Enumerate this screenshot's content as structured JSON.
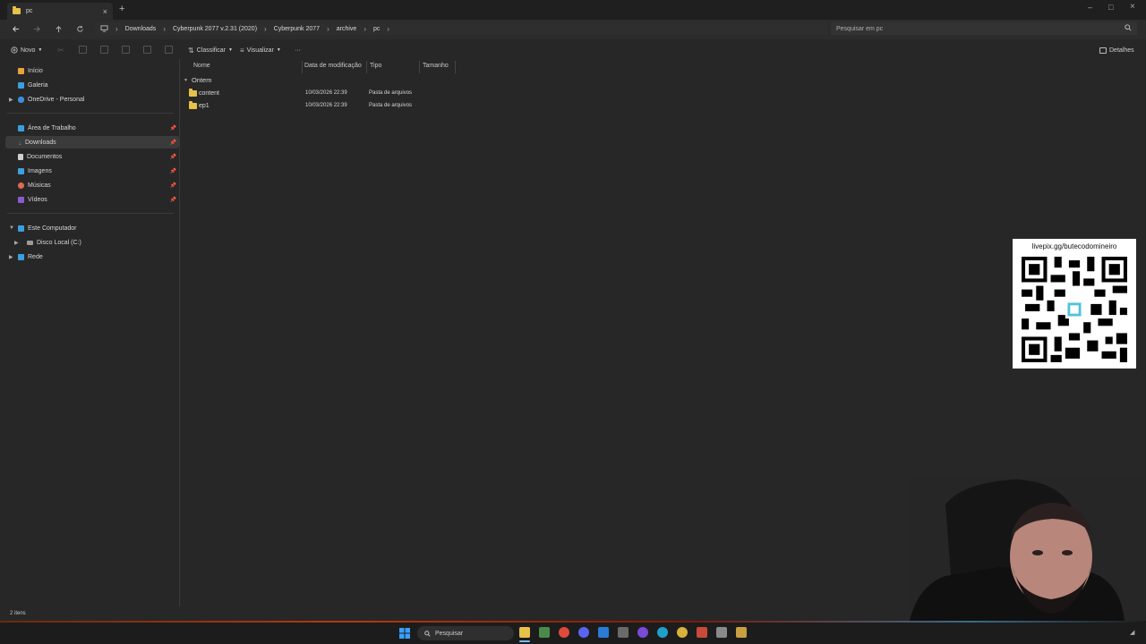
{
  "window": {
    "tab_title": "pc",
    "tab_close": "×",
    "new_tab": "+",
    "min": "–",
    "max": "□",
    "close": "×"
  },
  "address": {
    "breadcrumbs": [
      "Downloads",
      "Cyberpunk 2077 v.2.31 (2020)",
      "Cyberpunk 2077",
      "archive",
      "pc"
    ],
    "search_placeholder": "Pesquisar em pc"
  },
  "toolbar": {
    "new_label": "Novo",
    "sort_label": "Classificar",
    "view_label": "Visualizar",
    "more_label": "···",
    "details_label": "Detalhes"
  },
  "sidebar": {
    "items": [
      {
        "label": "Início",
        "icon": "home-icon",
        "color": "#e8a33c"
      },
      {
        "label": "Galeria",
        "icon": "gallery-icon",
        "color": "#3aa0e0"
      },
      {
        "label": "OneDrive - Personal",
        "icon": "cloud-icon",
        "color": "#3a8fd8"
      },
      {
        "label": "Área de Trabalho",
        "icon": "desktop-icon",
        "color": "#3a9fe0"
      },
      {
        "label": "Downloads",
        "icon": "download-icon",
        "color": "#3fb07a"
      },
      {
        "label": "Documentos",
        "icon": "document-icon",
        "color": "#d0d0d0"
      },
      {
        "label": "Imagens",
        "icon": "image-icon",
        "color": "#3aa0e0"
      },
      {
        "label": "Músicas",
        "icon": "music-icon",
        "color": "#e06a50"
      },
      {
        "label": "Vídeos",
        "icon": "video-icon",
        "color": "#8a5ad0"
      },
      {
        "label": "Este Computador",
        "icon": "computer-icon",
        "color": "#3a9fe0"
      },
      {
        "label": "Disco Local (C:)",
        "icon": "drive-icon",
        "color": "#9a9a9a"
      },
      {
        "label": "Rede",
        "icon": "network-icon",
        "color": "#3aa0e0"
      }
    ]
  },
  "columns": [
    "Nome",
    "Data de modificação",
    "Tipo",
    "Tamanho"
  ],
  "group_label": "Ontem",
  "files": [
    {
      "name": "content",
      "date": "10/03/2026 22:39",
      "type": "Pasta de arquivos"
    },
    {
      "name": "ep1",
      "date": "10/03/2026 22:39",
      "type": "Pasta de arquivos"
    }
  ],
  "status": {
    "count": "2 itens"
  },
  "taskbar": {
    "search_label": "Pesquisar"
  },
  "overlay": {
    "qr_caption": "livepix.gg/butecodomineiro"
  }
}
